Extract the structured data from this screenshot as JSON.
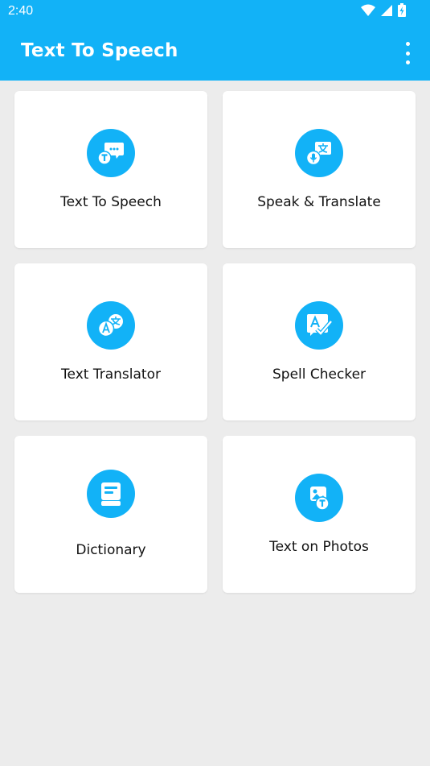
{
  "status": {
    "time": "2:40"
  },
  "app": {
    "title": "Text To Speech"
  },
  "colors": {
    "accent": "#12b2f7",
    "background": "#ececec",
    "card": "#ffffff"
  },
  "cards": [
    {
      "label": "Text To Speech",
      "icon": "chat-bubble-t-icon"
    },
    {
      "label": "Speak & Translate",
      "icon": "mic-translate-icon"
    },
    {
      "label": "Text Translator",
      "icon": "translate-icon"
    },
    {
      "label": "Spell Checker",
      "icon": "spell-check-icon"
    },
    {
      "label": "Dictionary",
      "icon": "book-icon"
    },
    {
      "label": "Text on Photos",
      "icon": "photo-text-icon"
    }
  ]
}
